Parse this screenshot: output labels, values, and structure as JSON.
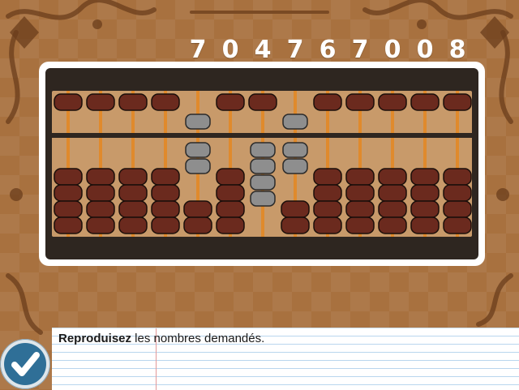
{
  "target_number": [
    "7",
    "0",
    "4",
    "7",
    "6",
    "7",
    "0",
    "0",
    "8"
  ],
  "abacus": {
    "rods": [
      {
        "upper_active": false,
        "lower_active": 0
      },
      {
        "upper_active": false,
        "lower_active": 0
      },
      {
        "upper_active": false,
        "lower_active": 0
      },
      {
        "upper_active": false,
        "lower_active": 0
      },
      {
        "upper_active": true,
        "lower_active": 2
      },
      {
        "upper_active": false,
        "lower_active": 0
      },
      {
        "upper_active": false,
        "lower_active": 4
      },
      {
        "upper_active": true,
        "lower_active": 2
      },
      {
        "upper_active": false,
        "lower_active": 0
      },
      {
        "upper_active": false,
        "lower_active": 0
      },
      {
        "upper_active": false,
        "lower_active": 0
      },
      {
        "upper_active": false,
        "lower_active": 0
      },
      {
        "upper_active": false,
        "lower_active": 0
      }
    ],
    "colors": {
      "inactive_bead": "#6b2a1e",
      "active_bead": "#8e8e8e",
      "rod": "#e08a2c",
      "frame": "#2e2620",
      "panel": "#c89a6a"
    }
  },
  "instruction": {
    "bold": "Reproduisez",
    "rest": " les nombres demandés."
  },
  "validate_button": {
    "icon": "checkmark-icon"
  }
}
